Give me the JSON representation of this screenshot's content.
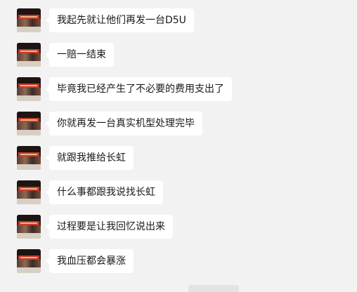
{
  "chat": {
    "messages": [
      {
        "sender": "contact",
        "text": "我起先就让他们再发一台D5U"
      },
      {
        "sender": "contact",
        "text": "一赔一结束"
      },
      {
        "sender": "contact",
        "text": "毕竟我已经产生了不必要的费用支出了"
      },
      {
        "sender": "contact",
        "text": "你就再发一台真实机型处理完毕"
      },
      {
        "sender": "contact",
        "text": "就跟我推给长虹"
      },
      {
        "sender": "contact",
        "text": "什么事都跟我说找长虹"
      },
      {
        "sender": "contact",
        "text": "过程要是让我回忆说出来"
      },
      {
        "sender": "contact",
        "text": "我血压都会暴涨"
      }
    ]
  },
  "colors": {
    "background": "#f2f2f2",
    "bubble": "#ffffff",
    "text": "#191919"
  }
}
